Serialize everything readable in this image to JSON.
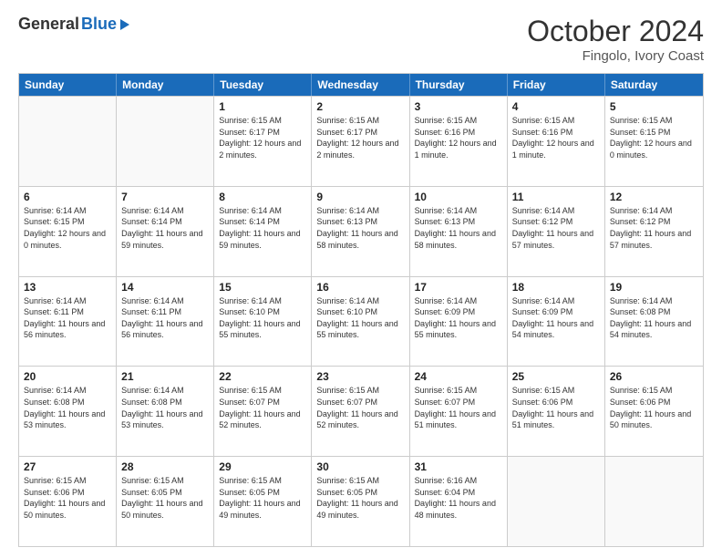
{
  "header": {
    "logo_general": "General",
    "logo_blue": "Blue",
    "month_title": "October 2024",
    "subtitle": "Fingolo, Ivory Coast"
  },
  "weekdays": [
    "Sunday",
    "Monday",
    "Tuesday",
    "Wednesday",
    "Thursday",
    "Friday",
    "Saturday"
  ],
  "rows": [
    [
      {
        "day": "",
        "info": ""
      },
      {
        "day": "",
        "info": ""
      },
      {
        "day": "1",
        "sunrise": "Sunrise: 6:15 AM",
        "sunset": "Sunset: 6:17 PM",
        "daylight": "Daylight: 12 hours and 2 minutes."
      },
      {
        "day": "2",
        "sunrise": "Sunrise: 6:15 AM",
        "sunset": "Sunset: 6:17 PM",
        "daylight": "Daylight: 12 hours and 2 minutes."
      },
      {
        "day": "3",
        "sunrise": "Sunrise: 6:15 AM",
        "sunset": "Sunset: 6:16 PM",
        "daylight": "Daylight: 12 hours and 1 minute."
      },
      {
        "day": "4",
        "sunrise": "Sunrise: 6:15 AM",
        "sunset": "Sunset: 6:16 PM",
        "daylight": "Daylight: 12 hours and 1 minute."
      },
      {
        "day": "5",
        "sunrise": "Sunrise: 6:15 AM",
        "sunset": "Sunset: 6:15 PM",
        "daylight": "Daylight: 12 hours and 0 minutes."
      }
    ],
    [
      {
        "day": "6",
        "sunrise": "Sunrise: 6:14 AM",
        "sunset": "Sunset: 6:15 PM",
        "daylight": "Daylight: 12 hours and 0 minutes."
      },
      {
        "day": "7",
        "sunrise": "Sunrise: 6:14 AM",
        "sunset": "Sunset: 6:14 PM",
        "daylight": "Daylight: 11 hours and 59 minutes."
      },
      {
        "day": "8",
        "sunrise": "Sunrise: 6:14 AM",
        "sunset": "Sunset: 6:14 PM",
        "daylight": "Daylight: 11 hours and 59 minutes."
      },
      {
        "day": "9",
        "sunrise": "Sunrise: 6:14 AM",
        "sunset": "Sunset: 6:13 PM",
        "daylight": "Daylight: 11 hours and 58 minutes."
      },
      {
        "day": "10",
        "sunrise": "Sunrise: 6:14 AM",
        "sunset": "Sunset: 6:13 PM",
        "daylight": "Daylight: 11 hours and 58 minutes."
      },
      {
        "day": "11",
        "sunrise": "Sunrise: 6:14 AM",
        "sunset": "Sunset: 6:12 PM",
        "daylight": "Daylight: 11 hours and 57 minutes."
      },
      {
        "day": "12",
        "sunrise": "Sunrise: 6:14 AM",
        "sunset": "Sunset: 6:12 PM",
        "daylight": "Daylight: 11 hours and 57 minutes."
      }
    ],
    [
      {
        "day": "13",
        "sunrise": "Sunrise: 6:14 AM",
        "sunset": "Sunset: 6:11 PM",
        "daylight": "Daylight: 11 hours and 56 minutes."
      },
      {
        "day": "14",
        "sunrise": "Sunrise: 6:14 AM",
        "sunset": "Sunset: 6:11 PM",
        "daylight": "Daylight: 11 hours and 56 minutes."
      },
      {
        "day": "15",
        "sunrise": "Sunrise: 6:14 AM",
        "sunset": "Sunset: 6:10 PM",
        "daylight": "Daylight: 11 hours and 55 minutes."
      },
      {
        "day": "16",
        "sunrise": "Sunrise: 6:14 AM",
        "sunset": "Sunset: 6:10 PM",
        "daylight": "Daylight: 11 hours and 55 minutes."
      },
      {
        "day": "17",
        "sunrise": "Sunrise: 6:14 AM",
        "sunset": "Sunset: 6:09 PM",
        "daylight": "Daylight: 11 hours and 55 minutes."
      },
      {
        "day": "18",
        "sunrise": "Sunrise: 6:14 AM",
        "sunset": "Sunset: 6:09 PM",
        "daylight": "Daylight: 11 hours and 54 minutes."
      },
      {
        "day": "19",
        "sunrise": "Sunrise: 6:14 AM",
        "sunset": "Sunset: 6:08 PM",
        "daylight": "Daylight: 11 hours and 54 minutes."
      }
    ],
    [
      {
        "day": "20",
        "sunrise": "Sunrise: 6:14 AM",
        "sunset": "Sunset: 6:08 PM",
        "daylight": "Daylight: 11 hours and 53 minutes."
      },
      {
        "day": "21",
        "sunrise": "Sunrise: 6:14 AM",
        "sunset": "Sunset: 6:08 PM",
        "daylight": "Daylight: 11 hours and 53 minutes."
      },
      {
        "day": "22",
        "sunrise": "Sunrise: 6:15 AM",
        "sunset": "Sunset: 6:07 PM",
        "daylight": "Daylight: 11 hours and 52 minutes."
      },
      {
        "day": "23",
        "sunrise": "Sunrise: 6:15 AM",
        "sunset": "Sunset: 6:07 PM",
        "daylight": "Daylight: 11 hours and 52 minutes."
      },
      {
        "day": "24",
        "sunrise": "Sunrise: 6:15 AM",
        "sunset": "Sunset: 6:07 PM",
        "daylight": "Daylight: 11 hours and 51 minutes."
      },
      {
        "day": "25",
        "sunrise": "Sunrise: 6:15 AM",
        "sunset": "Sunset: 6:06 PM",
        "daylight": "Daylight: 11 hours and 51 minutes."
      },
      {
        "day": "26",
        "sunrise": "Sunrise: 6:15 AM",
        "sunset": "Sunset: 6:06 PM",
        "daylight": "Daylight: 11 hours and 50 minutes."
      }
    ],
    [
      {
        "day": "27",
        "sunrise": "Sunrise: 6:15 AM",
        "sunset": "Sunset: 6:06 PM",
        "daylight": "Daylight: 11 hours and 50 minutes."
      },
      {
        "day": "28",
        "sunrise": "Sunrise: 6:15 AM",
        "sunset": "Sunset: 6:05 PM",
        "daylight": "Daylight: 11 hours and 50 minutes."
      },
      {
        "day": "29",
        "sunrise": "Sunrise: 6:15 AM",
        "sunset": "Sunset: 6:05 PM",
        "daylight": "Daylight: 11 hours and 49 minutes."
      },
      {
        "day": "30",
        "sunrise": "Sunrise: 6:15 AM",
        "sunset": "Sunset: 6:05 PM",
        "daylight": "Daylight: 11 hours and 49 minutes."
      },
      {
        "day": "31",
        "sunrise": "Sunrise: 6:16 AM",
        "sunset": "Sunset: 6:04 PM",
        "daylight": "Daylight: 11 hours and 48 minutes."
      },
      {
        "day": "",
        "info": ""
      },
      {
        "day": "",
        "info": ""
      }
    ]
  ]
}
